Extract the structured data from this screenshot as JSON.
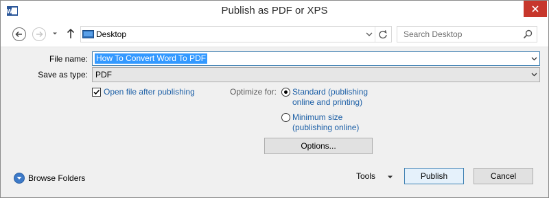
{
  "window": {
    "title": "Publish as PDF or XPS"
  },
  "nav": {
    "location": "Desktop",
    "search_placeholder": "Search Desktop"
  },
  "form": {
    "file_name_label": "File name:",
    "file_name_value": "How To Convert Word To PDF",
    "save_type_label": "Save as type:",
    "save_type_value": "PDF",
    "open_after_label": "Open file after publishing",
    "open_after_checked": true,
    "optimize_label": "Optimize for:",
    "standard_line1": "Standard (publishing",
    "standard_line2": "online and printing)",
    "minimum_line1": "Minimum size",
    "minimum_line2": "(publishing online)",
    "selected_optimize": "standard"
  },
  "buttons": {
    "options": "Options...",
    "publish": "Publish",
    "cancel": "Cancel",
    "tools": "Tools",
    "browse": "Browse Folders"
  },
  "colors": {
    "accent": "#3399ff",
    "link": "#1c5fa6",
    "close": "#c7372c",
    "word_blue": "#2b579a"
  }
}
